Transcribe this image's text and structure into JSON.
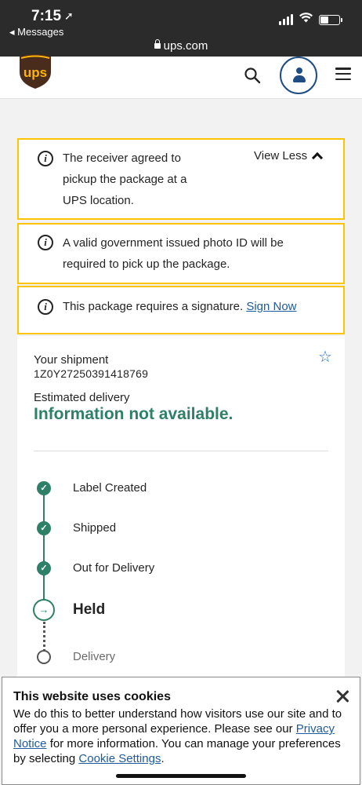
{
  "status_bar": {
    "time": "7:15",
    "back_app": "◂ Messages",
    "url": "ups.com"
  },
  "header": {
    "logo_text": "ups"
  },
  "alerts": [
    {
      "text": "The receiver agreed to pickup the package at a UPS location.",
      "toggle_label": "View Less"
    },
    {
      "text": "A valid government issued photo ID will be required to pick up the package."
    },
    {
      "text": "This package requires a signature.",
      "link": "Sign Now"
    }
  ],
  "shipment": {
    "label": "Your shipment",
    "tracking_number": "1Z0Y27250391418769",
    "estimated_label": "Estimated delivery",
    "estimated_value": "Information not available."
  },
  "timeline": {
    "steps": [
      {
        "label": "Label Created",
        "status": "complete"
      },
      {
        "label": "Shipped",
        "status": "complete"
      },
      {
        "label": "Out for Delivery",
        "status": "complete"
      },
      {
        "label": "Held",
        "status": "current"
      },
      {
        "label": "Delivery",
        "status": "pending"
      }
    ]
  },
  "cookie_banner": {
    "title": "This website uses cookies",
    "text_1": "We do this to better understand how visitors use our site and to offer you a more personal experience. Please see our ",
    "privacy_link": "Privacy Notice",
    "text_2": " for more information. You can manage your preferences by selecting ",
    "settings_link": "Cookie Settings",
    "text_3": "."
  },
  "colors": {
    "brand_brown": "#4a2c1c",
    "brand_gold": "#ffb500",
    "alert_border": "#ffc400",
    "progress_green": "#2e8066",
    "link_blue": "#1e5a9c"
  }
}
